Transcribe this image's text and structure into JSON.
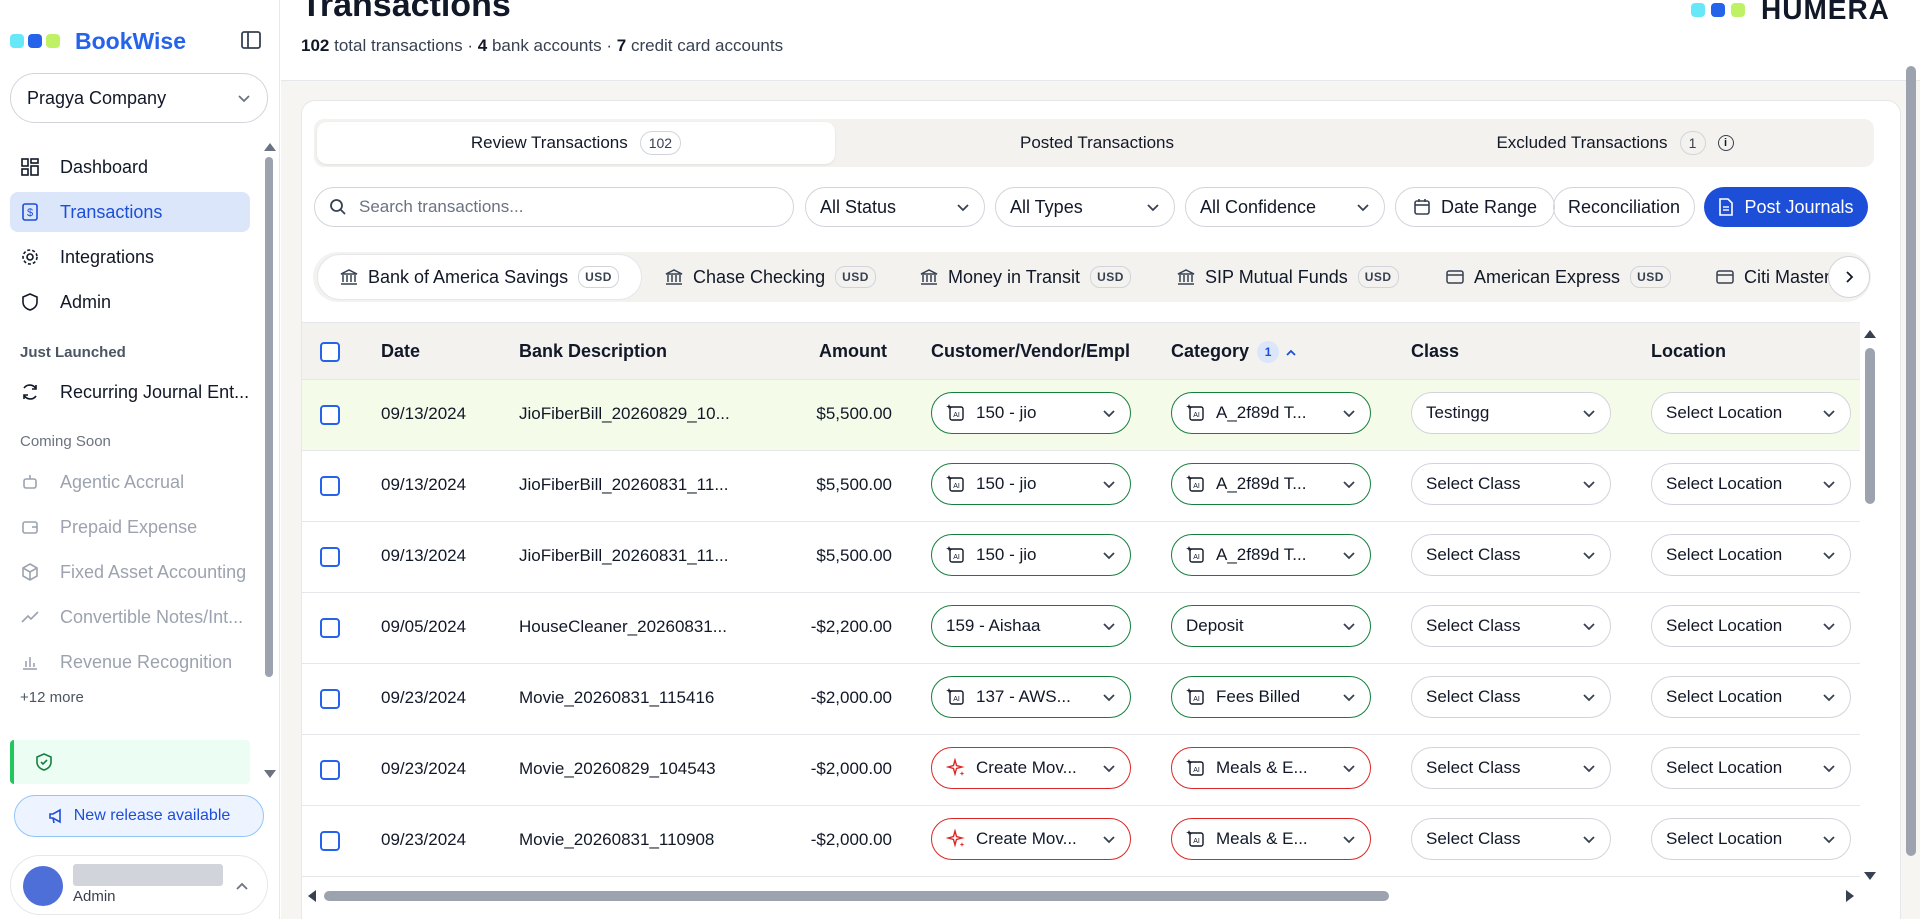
{
  "sidebar": {
    "brand": "BookWise",
    "company": "Pragya Company",
    "nav": [
      {
        "label": "Dashboard",
        "icon": "dashboard-icon"
      },
      {
        "label": "Transactions",
        "icon": "dollar-doc-icon"
      },
      {
        "label": "Integrations",
        "icon": "gear-icon"
      },
      {
        "label": "Admin",
        "icon": "shield-icon"
      }
    ],
    "just_launched_label": "Just Launched",
    "just_launched": [
      {
        "label": "Recurring Journal Ent...",
        "icon": "recurring-icon"
      }
    ],
    "coming_soon_label": "Coming Soon",
    "coming_soon": [
      {
        "label": "Agentic Accrual",
        "icon": "robot-icon"
      },
      {
        "label": "Prepaid Expense",
        "icon": "wallet-icon"
      },
      {
        "label": "Fixed Asset Accounting",
        "icon": "box-icon"
      },
      {
        "label": "Convertible Notes/Int...",
        "icon": "trend-icon"
      },
      {
        "label": "Revenue Recognition",
        "icon": "bar-chart-icon"
      }
    ],
    "more": "+12 more",
    "release": "New release available",
    "user_role": "Admin"
  },
  "header": {
    "title": "Transactions",
    "total": "102",
    "total_label": "total transactions",
    "bank": "4",
    "bank_label": "bank accounts",
    "cc": "7",
    "cc_label": "credit card accounts",
    "sep": "·",
    "brand_right": "HUMERA"
  },
  "tabs": [
    {
      "label": "Review Transactions",
      "count": "102"
    },
    {
      "label": "Posted Transactions"
    },
    {
      "label": "Excluded Transactions",
      "count": "1"
    }
  ],
  "toolbar": {
    "search_placeholder": "Search transactions...",
    "status": "All Status",
    "types": "All Types",
    "confidence": "All Confidence",
    "date_range": "Date Range",
    "reconciliation": "Reconciliation",
    "post": "Post Journals"
  },
  "accounts": [
    {
      "label": "Bank of America Savings",
      "cur": "USD"
    },
    {
      "label": "Chase Checking",
      "cur": "USD"
    },
    {
      "label": "Money in Transit",
      "cur": "USD"
    },
    {
      "label": "SIP Mutual Funds",
      "cur": "USD"
    },
    {
      "label": "American Express",
      "cur": "USD"
    },
    {
      "label": "Citi Master"
    }
  ],
  "table": {
    "columns": [
      "Date",
      "Bank Description",
      "Amount",
      "Customer/Vendor/Empl",
      "Category",
      "Class",
      "Location"
    ],
    "category_badge": "1",
    "rows": [
      {
        "date": "09/13/2024",
        "desc": "JioFiberBill_20260829_10...",
        "amount": "$5,500.00",
        "vendor": "150 - jio",
        "category": "A_2f89d T...",
        "class": "Testingg",
        "location": "Select Location"
      },
      {
        "date": "09/13/2024",
        "desc": "JioFiberBill_20260831_11...",
        "amount": "$5,500.00",
        "vendor": "150 - jio",
        "category": "A_2f89d T...",
        "class": "Select Class",
        "location": "Select Location"
      },
      {
        "date": "09/13/2024",
        "desc": "JioFiberBill_20260831_11...",
        "amount": "$5,500.00",
        "vendor": "150 - jio",
        "category": "A_2f89d T...",
        "class": "Select Class",
        "location": "Select Location"
      },
      {
        "date": "09/05/2024",
        "desc": "HouseCleaner_20260831...",
        "amount": "-$2,200.00",
        "vendor": "159 - Aishaa",
        "category": "Deposit",
        "class": "Select Class",
        "location": "Select Location"
      },
      {
        "date": "09/23/2024",
        "desc": "Movie_20260831_115416",
        "amount": "-$2,000.00",
        "vendor": "137 - AWS...",
        "category": "Fees Billed",
        "class": "Select Class",
        "location": "Select Location"
      },
      {
        "date": "09/23/2024",
        "desc": "Movie_20260829_104543",
        "amount": "-$2,000.00",
        "vendor": "Create Mov...",
        "category": "Meals & E...",
        "class": "Select Class",
        "location": "Select Location"
      },
      {
        "date": "09/23/2024",
        "desc": "Movie_20260831_110908",
        "amount": "-$2,000.00",
        "vendor": "Create Mov...",
        "category": "Meals & E...",
        "class": "Select Class",
        "location": "Select Location"
      }
    ]
  },
  "colors": {
    "accent": "#1d4ed8",
    "ai_green": "#15803d",
    "create_red": "#dc2626",
    "highlight_row": "#f5fbe9"
  }
}
